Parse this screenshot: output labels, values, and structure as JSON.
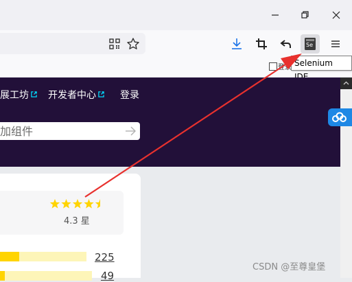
{
  "window": {
    "minimize_icon": "minimize-icon",
    "restore_icon": "restore-icon",
    "close_icon": "close-icon"
  },
  "toolbar": {
    "icons": [
      "qr-code-icon",
      "bookmark-star-icon",
      "download-icon",
      "crop-icon",
      "reply-arrow-icon",
      "selenium-ide-icon",
      "hamburger-menu-icon"
    ],
    "selenium_ext_label": "Se",
    "tooltip": "Selenium IDE"
  },
  "nav": {
    "links": [
      {
        "label": "展工坊"
      },
      {
        "label": "开发者中心"
      },
      {
        "label": "登录"
      }
    ]
  },
  "search": {
    "placeholder": "加组件"
  },
  "rating": {
    "value_text": "4.3 星",
    "value": 4.3,
    "max": 5,
    "bars": [
      {
        "fraction": 0.22,
        "count": "225"
      },
      {
        "fraction": 0.05,
        "count": "49"
      }
    ]
  },
  "watermark": "CSDN @至尊皇堡",
  "colors": {
    "hero_bg": "#221039",
    "accent_link": "#00ddff",
    "star": "#ffd400",
    "annotation_arrow": "#e8312e",
    "float_button": "#1e88e5"
  }
}
